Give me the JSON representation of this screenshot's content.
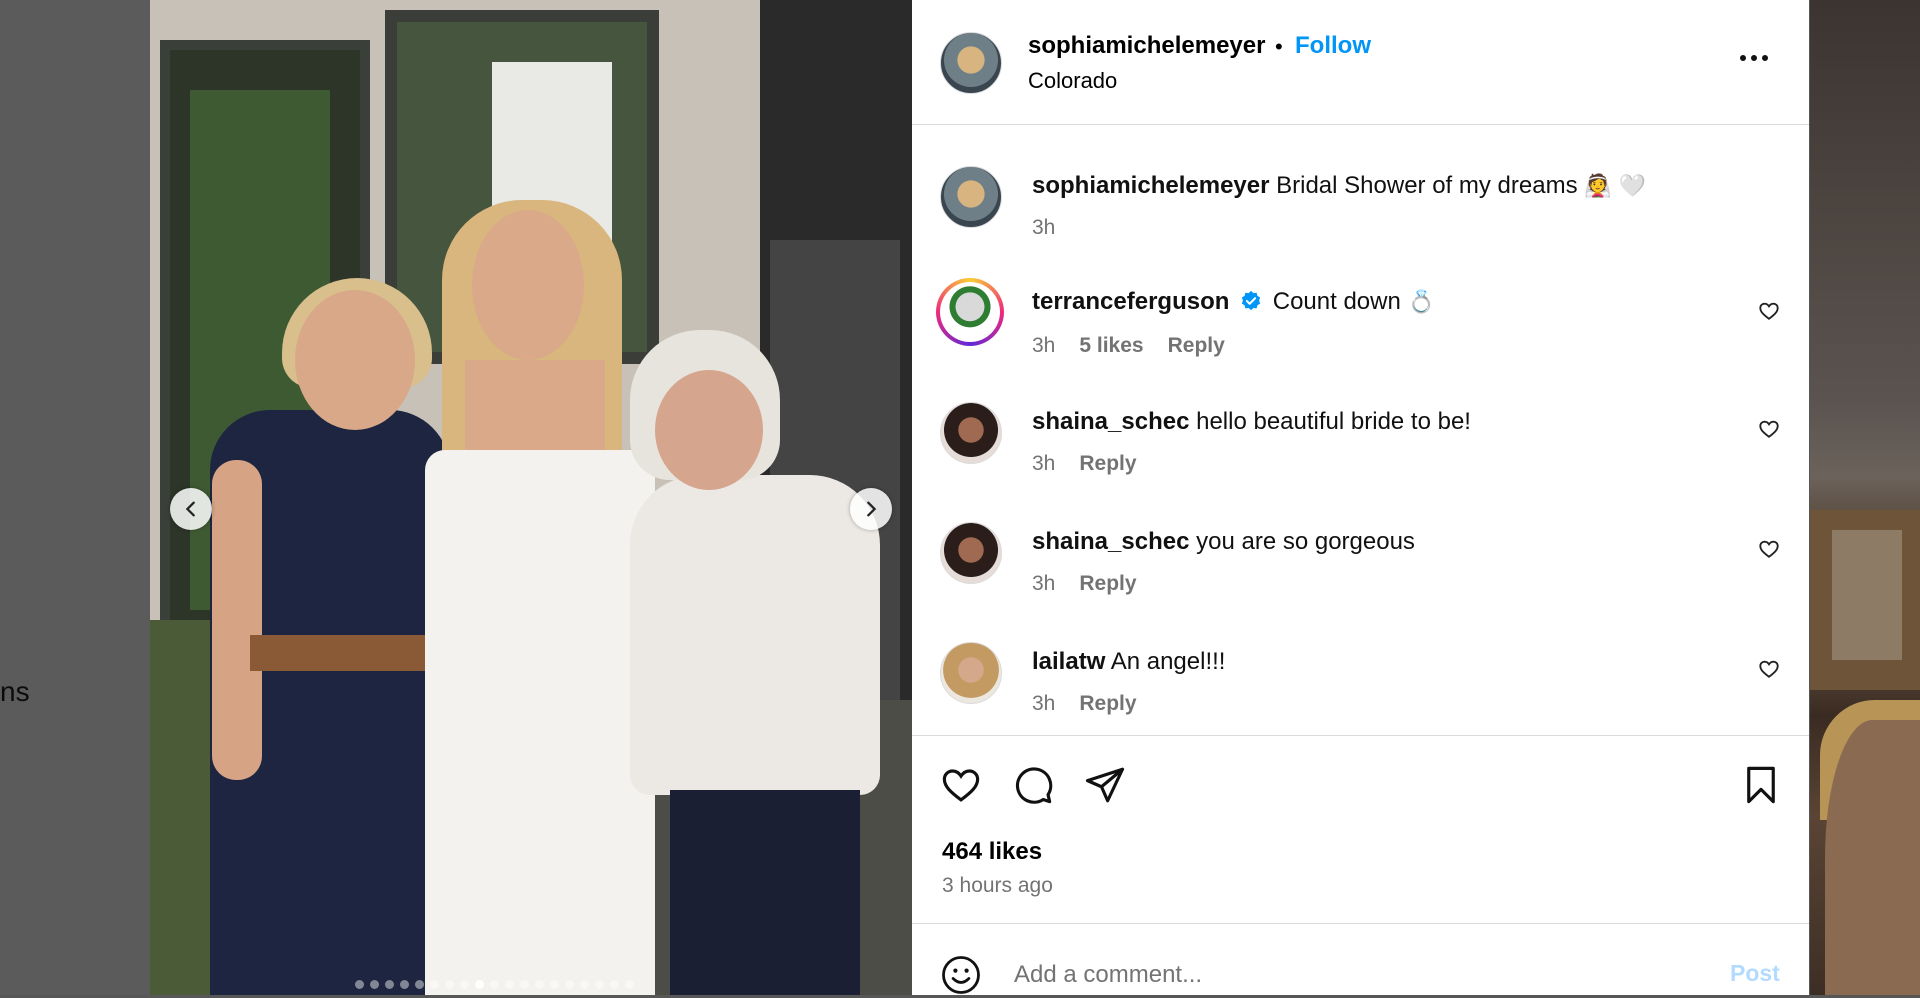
{
  "background": {
    "left_text": "ns"
  },
  "post": {
    "author": "sophiamichelemeyer",
    "separator": "•",
    "follow_label": "Follow",
    "location": "Colorado",
    "carousel": {
      "dot_count": 19,
      "active_index": 8
    }
  },
  "caption": {
    "username": "sophiamichelemeyer",
    "text": "Bridal Shower of my dreams",
    "emoji": "👰 🤍",
    "time": "3h"
  },
  "comments": [
    {
      "username": "terranceferguson",
      "verified": true,
      "text": "Count down",
      "emoji": "💍",
      "time": "3h",
      "likes": "5 likes",
      "reply": "Reply"
    },
    {
      "username": "shaina_schec",
      "verified": false,
      "text": "hello beautiful bride to be!",
      "emoji": "",
      "time": "3h",
      "likes": "",
      "reply": "Reply"
    },
    {
      "username": "shaina_schec",
      "verified": false,
      "text": "you are so gorgeous",
      "emoji": "",
      "time": "3h",
      "likes": "",
      "reply": "Reply"
    },
    {
      "username": "lailatw",
      "verified": false,
      "text": "An angel!!!",
      "emoji": "",
      "time": "3h",
      "likes": "",
      "reply": "Reply"
    }
  ],
  "stats": {
    "likes": "464 likes",
    "posted": "3 hours ago"
  },
  "add_comment": {
    "placeholder": "Add a comment...",
    "post_label": "Post"
  },
  "colors": {
    "follow": "#0095f6",
    "post_disabled": "#b3dbff",
    "meta": "#737373",
    "verified": "#0095f6"
  }
}
